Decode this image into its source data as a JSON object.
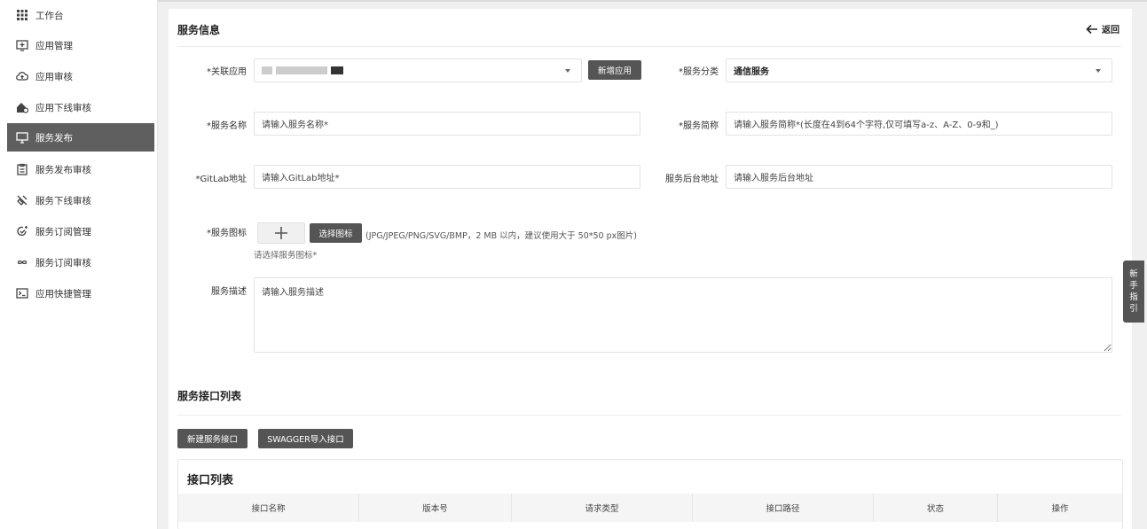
{
  "sidebar": {
    "items": [
      {
        "label": "工作台",
        "icon": "grid-icon"
      },
      {
        "label": "应用管理",
        "icon": "app-add-icon"
      },
      {
        "label": "应用审核",
        "icon": "cloud-upload-icon"
      },
      {
        "label": "应用下线审核",
        "icon": "offline-review-icon"
      },
      {
        "label": "服务发布",
        "icon": "monitor-icon",
        "active": true
      },
      {
        "label": "服务发布审核",
        "icon": "clipboard-icon"
      },
      {
        "label": "服务下线审核",
        "icon": "unplug-icon"
      },
      {
        "label": "服务订阅管理",
        "icon": "subscribe-icon"
      },
      {
        "label": "服务订阅审核",
        "icon": "infinity-icon"
      },
      {
        "label": "应用快捷管理",
        "icon": "terminal-icon"
      }
    ]
  },
  "service_info": {
    "title": "服务信息",
    "back_label": "返回",
    "related_app_label": "*关联应用",
    "add_app_button": "新增应用",
    "category_label": "*服务分类",
    "category_value": "通信服务",
    "name_label": "*服务名称",
    "name_placeholder": "请输入服务名称*",
    "short_name_label": "*服务简称",
    "short_name_placeholder": "请输入服务简称*(长度在4到64个字符,仅可填写a-z、A-Z、0-9和_)",
    "gitlab_label": "*GitLab地址",
    "gitlab_placeholder": "请输入GitLab地址*",
    "backend_label": "服务后台地址",
    "backend_placeholder": "请输入服务后台地址",
    "icon_label": "*服务图标",
    "choose_icon_button": "选择图标",
    "icon_hint": "(JPG/JPEG/PNG/SVG/BMP，2 MB 以内，建议使用大于 50*50 px图片)",
    "icon_required_hint": "请选择服务图标*",
    "desc_label": "服务描述",
    "desc_placeholder": "请输入服务描述"
  },
  "interface_section": {
    "title": "服务接口列表",
    "new_button": "新建服务接口",
    "swagger_button": "SWAGGER导入接口",
    "list_title": "接口列表",
    "columns": [
      "接口名称",
      "版本号",
      "请求类型",
      "接口路径",
      "状态",
      "操作"
    ]
  },
  "guide_tab": [
    "新",
    "手",
    "指",
    "引"
  ]
}
